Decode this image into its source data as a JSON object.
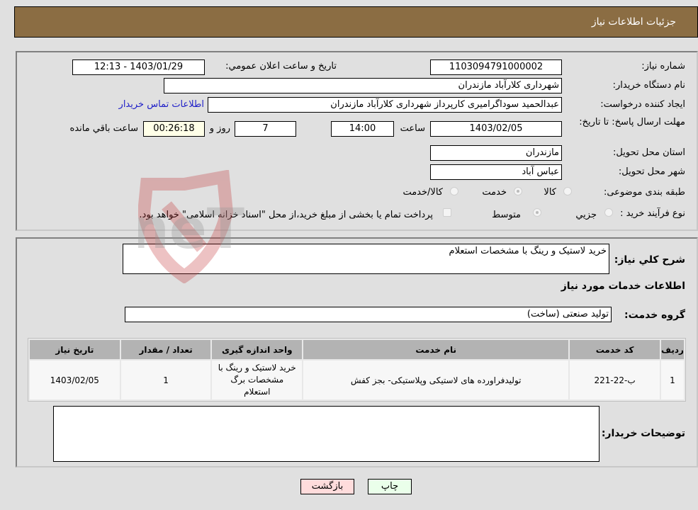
{
  "header": {
    "title": "جزئیات اطلاعات نیاز"
  },
  "form": {
    "need_number": {
      "label": "شماره نیاز:",
      "value": "1103094791000002"
    },
    "announce_datetime": {
      "label": "تاریخ و ساعت اعلان عمومي:",
      "value": "1403/01/29 - 12:13"
    },
    "buyer_org": {
      "label": "نام دستگاه خریدار:",
      "value": "شهرداری کلارآباد   مازندران"
    },
    "requester": {
      "label": "ایجاد کننده درخواست:",
      "value": "عبدالحمید سوداگرامیری کارپرداز شهرداری کلارآباد   مازندران"
    },
    "buyer_contact_link": "اطلاعات تماس خریدار",
    "deadline": {
      "label": "مهلت ارسال پاسخ: تا تاریخ:",
      "date": "1403/02/05",
      "time_label": "ساعت",
      "time": "14:00",
      "days": "7",
      "days_label": "روز و",
      "remaining": "00:26:18",
      "remaining_label": "ساعت باقي مانده"
    },
    "delivery_province": {
      "label": "استان محل تحویل:",
      "value": "مازندران"
    },
    "delivery_city": {
      "label": "شهر محل تحویل:",
      "value": "عباس آباد"
    },
    "category": {
      "label": "طبقه بندی موضوعی:",
      "options": [
        "کالا",
        "خدمت",
        "کالا/خدمت"
      ],
      "selected": "خدمت"
    },
    "purchase_type": {
      "label": "نوع فرآیند خرید :",
      "options": [
        "جزيي",
        "متوسط"
      ],
      "selected": "متوسط",
      "treasury_note": "پرداخت تمام یا بخشی از مبلغ خرید،از محل \"اسناد خزانه اسلامی\" خواهد بود."
    }
  },
  "details": {
    "description_label": "شرح کلي نیاز:",
    "description": "خرید لاستیک و رینگ با مشخصات استعلام",
    "services_heading": "اطلاعات خدمات مورد نیاز",
    "service_group_label": "گروه خدمت:",
    "service_group": "تولید صنعتی (ساخت)",
    "table": {
      "headers": [
        "ردیف",
        "کد خدمت",
        "نام خدمت",
        "واحد اندازه گیری",
        "تعداد / مقدار",
        "تاریخ نیاز"
      ],
      "rows": [
        [
          "1",
          "ب-22-221",
          "تولیدفراورده های لاستیکی وپلاستیکی- بجز کفش",
          "خرید لاستیک و رینگ با مشخصات برگ استعلام",
          "1",
          "1403/02/05"
        ]
      ]
    },
    "buyer_notes_label": "توضیحات خریدار:",
    "buyer_notes": ""
  },
  "buttons": {
    "print": "چاپ",
    "back": "بازگشت"
  },
  "watermark": "AriaTender.neT",
  "colors": {
    "header_bg": "#8b6d43",
    "print_bg": "#eaffea",
    "back_bg": "#ffdcdc",
    "link": "#2020c8"
  }
}
